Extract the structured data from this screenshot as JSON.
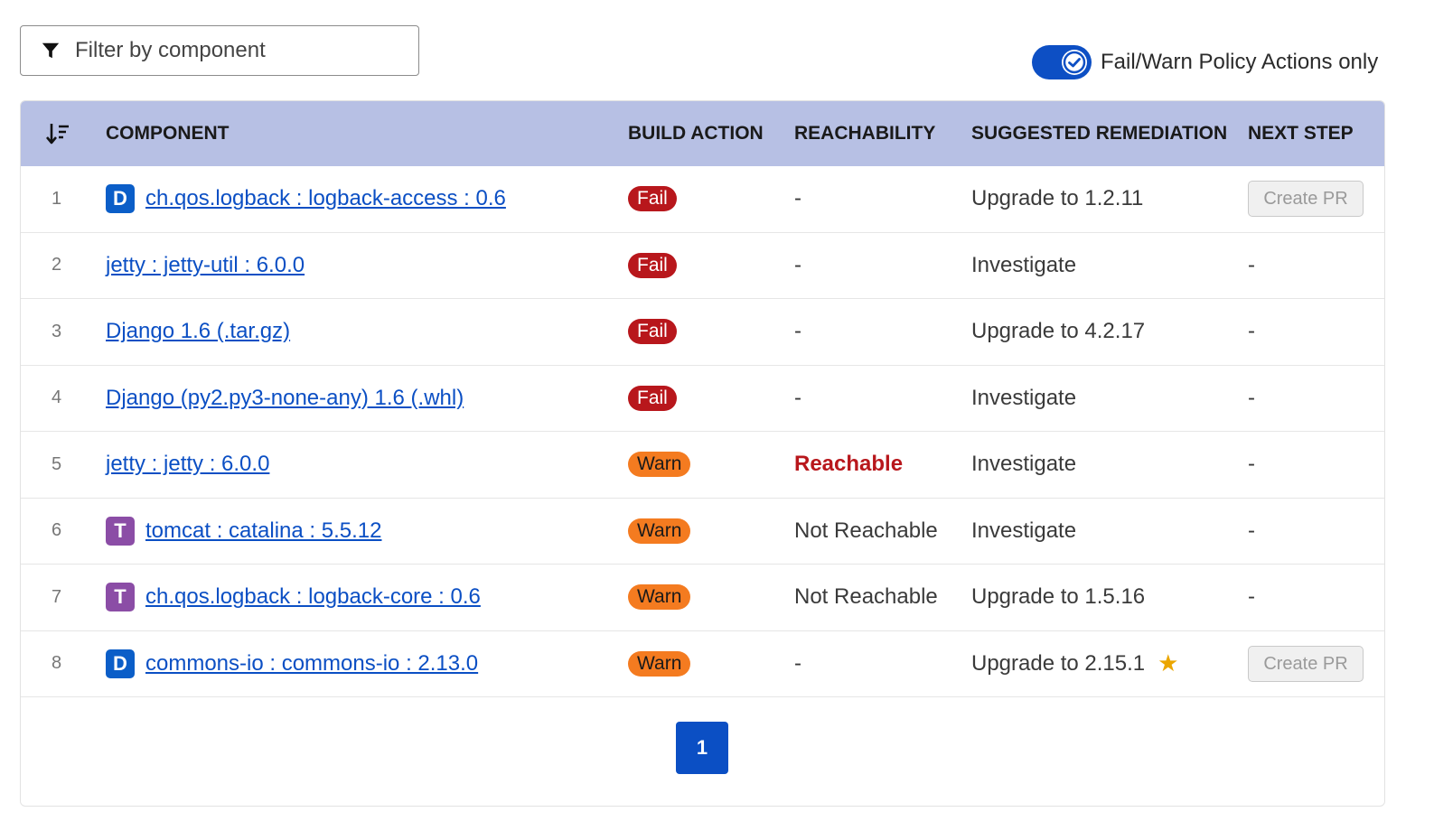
{
  "filter": {
    "placeholder": "Filter by component",
    "icon": "filter-icon"
  },
  "policy_toggle": {
    "label": "Fail/Warn Policy Actions only",
    "enabled": true,
    "color": "#0d4fc4"
  },
  "table": {
    "sort_icon": "sort-descending-icon",
    "header_bg": "#b7c0e4",
    "columns": {
      "component": "COMPONENT",
      "build_action": "BUILD ACTION",
      "reachability": "REACHABILITY",
      "remediation": "SUGGESTED REMEDIATION",
      "next_step": "NEXT STEP"
    },
    "rows": [
      {
        "num": "1",
        "badge": "D",
        "component": "ch.qos.logback : logback-access : 0.6",
        "build_action": "Fail",
        "reachability": "-",
        "remediation": "Upgrade to 1.2.11",
        "next_step": "Create PR",
        "star": false
      },
      {
        "num": "2",
        "badge": "",
        "component": "jetty : jetty-util : 6.0.0",
        "build_action": "Fail",
        "reachability": "-",
        "remediation": "Investigate",
        "next_step": "-",
        "star": false
      },
      {
        "num": "3",
        "badge": "",
        "component": "Django 1.6 (.tar.gz)",
        "build_action": "Fail",
        "reachability": "-",
        "remediation": "Upgrade to 4.2.17",
        "next_step": "-",
        "star": false
      },
      {
        "num": "4",
        "badge": "",
        "component": "Django (py2.py3-none-any) 1.6 (.whl)",
        "build_action": "Fail",
        "reachability": "-",
        "remediation": "Investigate",
        "next_step": "-",
        "star": false
      },
      {
        "num": "5",
        "badge": "",
        "component": "jetty : jetty : 6.0.0",
        "build_action": "Warn",
        "reachability": "Reachable",
        "remediation": "Investigate",
        "next_step": "-",
        "star": false
      },
      {
        "num": "6",
        "badge": "T",
        "component": "tomcat : catalina : 5.5.12",
        "build_action": "Warn",
        "reachability": "Not Reachable",
        "remediation": "Investigate",
        "next_step": "-",
        "star": false
      },
      {
        "num": "7",
        "badge": "T",
        "component": "ch.qos.logback : logback-core : 0.6",
        "build_action": "Warn",
        "reachability": "Not Reachable",
        "remediation": "Upgrade to 1.5.16",
        "next_step": "-",
        "star": false
      },
      {
        "num": "8",
        "badge": "D",
        "component": "commons-io : commons-io : 2.13.0",
        "build_action": "Warn",
        "reachability": "-",
        "remediation": "Upgrade to 2.15.1",
        "next_step": "Create PR",
        "star": true
      }
    ]
  },
  "pagination": {
    "current_page": "1"
  },
  "colors": {
    "fail": "#b8171c",
    "warn": "#f47b20",
    "link": "#0b4fc4",
    "badge_d": "#0b5ec8",
    "badge_t": "#8b4da6",
    "star": "#eba600"
  }
}
